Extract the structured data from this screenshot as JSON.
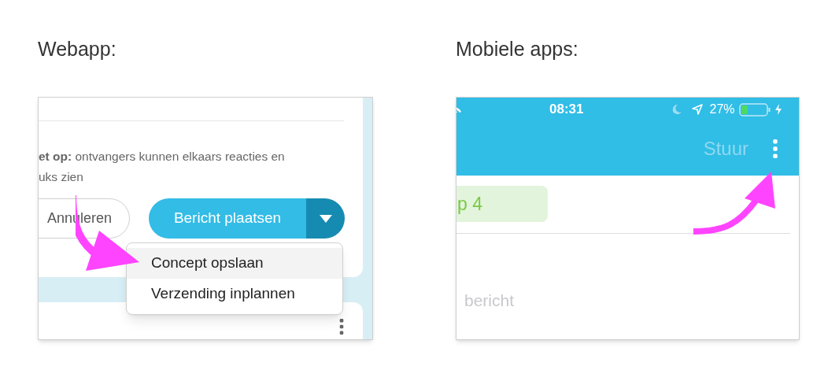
{
  "webapp": {
    "heading": "Webapp:",
    "notice_lines": [
      "**et op:** ontvangers kunnen elkaars reacties en",
      "uks zien"
    ],
    "cancel_button": "Annuleren",
    "post_button": "Bericht plaatsen",
    "menu": [
      {
        "label": "Concept opslaan",
        "selected": true
      },
      {
        "label": "Verzending inplannen",
        "selected": false
      }
    ]
  },
  "mobile": {
    "heading": "Mobiele apps:",
    "status_bar": {
      "time": "08:31",
      "battery_text": "27%"
    },
    "send_button": {
      "label": "Stuur",
      "disabled": true
    },
    "chip": "p 4",
    "message_placeholder": "bericht"
  }
}
